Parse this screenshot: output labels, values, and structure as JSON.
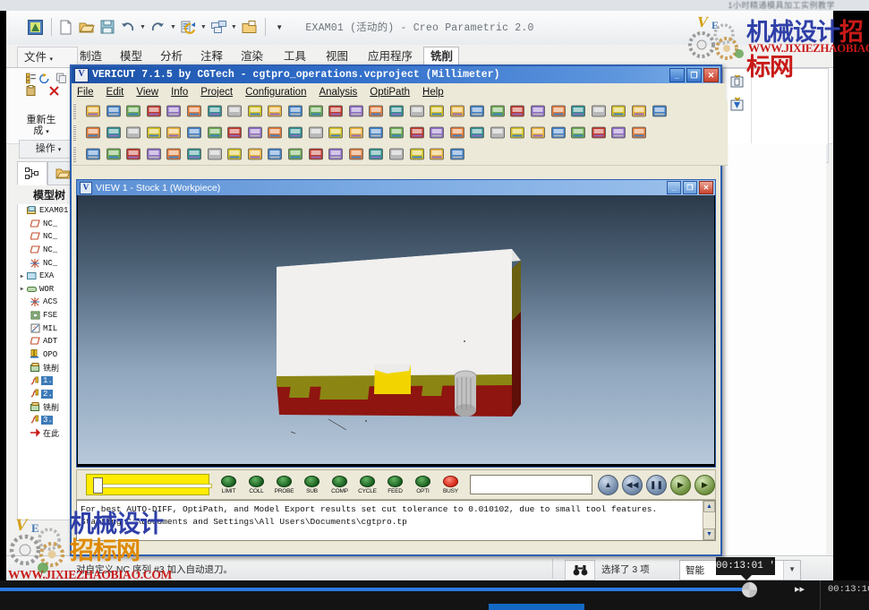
{
  "video": {
    "top_caption": "1小时精通模具加工实例教学",
    "time_current": "00:13:10/",
    "tooltip_time": "00:13:01 '"
  },
  "creo": {
    "title": "EXAM01 (活动的) - Creo Parametric 2.0",
    "quick_access": [
      {
        "name": "app-logo-icon",
        "glyph": "▣"
      },
      {
        "name": "new-file-icon",
        "glyph": "🗋"
      },
      {
        "name": "open-file-icon",
        "glyph": "📂"
      },
      {
        "name": "save-icon",
        "glyph": "💾"
      },
      {
        "name": "undo-icon",
        "glyph": "↶"
      },
      {
        "name": "redo-icon",
        "glyph": "↷"
      },
      {
        "name": "regenerate-icon",
        "glyph": "⟳"
      },
      {
        "name": "window-layout-icon",
        "glyph": "▤"
      },
      {
        "name": "close-window-icon",
        "glyph": "📁"
      },
      {
        "name": "overflow-icon",
        "glyph": "▼"
      }
    ],
    "tabs": [
      {
        "label": "文件",
        "selected": false,
        "has_arrow": true
      },
      {
        "label": "制造",
        "selected": false
      },
      {
        "label": "模型",
        "selected": false
      },
      {
        "label": "分析",
        "selected": false
      },
      {
        "label": "注释",
        "selected": false
      },
      {
        "label": "渲染",
        "selected": false
      },
      {
        "label": "工具",
        "selected": false
      },
      {
        "label": "视图",
        "selected": false
      },
      {
        "label": "应用程序",
        "selected": false
      },
      {
        "label": "铣削",
        "selected": true
      }
    ],
    "ribbon": {
      "regenerate_label": "重新生\n成",
      "operations_label": "操作"
    },
    "tree": {
      "header": "模型树",
      "tab_icons": [
        "model-tree-icon",
        "folder-browser-icon"
      ],
      "nodes": [
        {
          "label": "EXAM01.",
          "icon": "assembly-icon",
          "expander": "",
          "selected": false
        },
        {
          "label": "NC_",
          "icon": "datum-plane-icon",
          "expander": "",
          "selected": false
        },
        {
          "label": "NC_",
          "icon": "datum-plane-icon",
          "expander": "",
          "selected": false
        },
        {
          "label": "NC_",
          "icon": "datum-plane-icon",
          "expander": "",
          "selected": false
        },
        {
          "label": "NC_",
          "icon": "coord-sys-icon",
          "expander": "",
          "selected": false
        },
        {
          "label": "EXA",
          "icon": "part-icon",
          "expander": "▶",
          "selected": false
        },
        {
          "label": "WOR",
          "icon": "workpiece-icon",
          "expander": "▶",
          "selected": false
        },
        {
          "label": "ACS",
          "icon": "coord-sys-icon",
          "expander": "",
          "selected": false
        },
        {
          "label": "FSE",
          "icon": "fixture-icon",
          "expander": "",
          "selected": false
        },
        {
          "label": "MIL",
          "icon": "mill-op-icon",
          "expander": "",
          "selected": false
        },
        {
          "label": "ADT",
          "icon": "datum-plane-icon",
          "expander": "",
          "selected": false
        },
        {
          "label": "OPO",
          "icon": "tool-icon",
          "expander": "",
          "selected": false
        },
        {
          "label": "铣削",
          "icon": "nc-seq-icon",
          "expander": "",
          "selected": false
        },
        {
          "label": "1. ",
          "icon": "cut-motion-icon",
          "expander": "",
          "selected": true
        },
        {
          "label": "2. ",
          "icon": "cut-motion-icon",
          "expander": "",
          "selected": true
        },
        {
          "label": "铣削",
          "icon": "nc-seq-icon",
          "expander": "",
          "selected": false
        },
        {
          "label": "3. ",
          "icon": "cut-motion-icon",
          "expander": "",
          "selected": true
        },
        {
          "label": "在此",
          "icon": "insert-here-icon",
          "expander": "",
          "selected": false
        }
      ]
    },
    "statusbar": {
      "message": "对自定义 NC 序列 #3 加入自动退刀。",
      "find_icon": "binoculars-icon",
      "selection": "选择了 3 项",
      "filter_value": "智能",
      "filter_arrow": "▼"
    }
  },
  "vericut": {
    "title": "VERICUT 7.1.5 by CGTech - cgtpro_operations.vcproject (Millimeter)",
    "logo": "V",
    "window_buttons": [
      {
        "name": "minimize-button",
        "glyph": "_"
      },
      {
        "name": "maximize-button",
        "glyph": "❐"
      },
      {
        "name": "close-button",
        "glyph": "✕"
      }
    ],
    "menu": [
      {
        "label": "File"
      },
      {
        "label": "Edit"
      },
      {
        "label": "View"
      },
      {
        "label": "Info"
      },
      {
        "label": "Project"
      },
      {
        "label": "Configuration"
      },
      {
        "label": "Analysis"
      },
      {
        "label": "OptiPath"
      },
      {
        "label": "Help"
      }
    ],
    "toolbar_row1": [
      "open-project-icon",
      "open-vc-icon",
      "open-mm-icon",
      "open-folder-icon",
      "save-ip-icon",
      "save-up-icon",
      "import-icon",
      "new-model-icon",
      "report-icon",
      "save-as-icon",
      "open-m-icon",
      "open-c-icon",
      "tool-manager-icon",
      "enter-icon",
      "machine-icon",
      "g-code-icon",
      "apt-icon",
      "nc-program-icon",
      "stop-icon",
      "save-file-icon",
      "compare-icon",
      "shield-icon",
      "library-icon",
      "machine-setup-icon",
      "axis-icon",
      "model-h-icon",
      "model-g-icon",
      "merge-icon",
      "gm-xy-icon"
    ],
    "toolbar_row2": [
      "g1-icon",
      "step-icon",
      "step-all-icon",
      "tool-pick-icon",
      "verify-icon",
      "insert-icon",
      "diamond-gold-icon",
      "diamond-gray-icon",
      "diamond-green-icon",
      "section-icon",
      "colors-icon",
      "palette-icon",
      "zoom-icon",
      "zoom-in-icon",
      "zoom-out-icon",
      "fit-icon",
      "rotate-icon",
      "translate-icon",
      "refresh-icon",
      "measure-icon",
      "info-icon",
      "graph-icon",
      "autodiff-icon",
      "delete-x-icon",
      "feature-icon",
      "optipath-icon",
      "box-icon",
      "render-icon"
    ],
    "toolbar_row3": [
      "checker-icon",
      "record-icon",
      "anchor-icon",
      "view-icon",
      "print-icon",
      "rotate-x-icon",
      "rotate-y-icon",
      "rotate-z-icon",
      "rotate-xy-icon",
      "pan-icon",
      "perspective-icon",
      "layout-1-icon",
      "layout-2-icon",
      "layout-2h-icon",
      "layout-3-icon",
      "layout-3b-icon",
      "layout-4-icon",
      "spi-icon",
      "cancel-x-icon"
    ],
    "view_window": {
      "title": "VIEW 1 - Stock 1 (Workpiece)",
      "logo": "V",
      "buttons": [
        {
          "name": "view-minimize-button",
          "glyph": "_"
        },
        {
          "name": "view-maximize-button",
          "glyph": "❐"
        },
        {
          "name": "view-close-button",
          "glyph": "✕"
        }
      ],
      "colors": {
        "stock_top": "#f0efee",
        "stock_side": "#8f1410",
        "stock_band": "#8f8915",
        "cut_pocket": "#f2d500",
        "tool": "#b9b9b9"
      }
    },
    "controls": {
      "leds": [
        {
          "label": "LIMIT",
          "state": "green"
        },
        {
          "label": "COLL",
          "state": "green"
        },
        {
          "label": "PROBE",
          "state": "green"
        },
        {
          "label": "SUB",
          "state": "green"
        },
        {
          "label": "COMP",
          "state": "green"
        },
        {
          "label": "CYCLE",
          "state": "green"
        },
        {
          "label": "FEED",
          "state": "green"
        },
        {
          "label": "OPTI",
          "state": "green"
        },
        {
          "label": "BUSY",
          "state": "red"
        }
      ],
      "status_field": "",
      "nav_buttons": [
        {
          "name": "eject-button",
          "glyph": "▲"
        },
        {
          "name": "rewind-button",
          "glyph": "◀◀"
        },
        {
          "name": "pause-button",
          "glyph": "❚❚"
        },
        {
          "name": "step-button",
          "glyph": "▶"
        },
        {
          "name": "play-button",
          "glyph": "▶"
        }
      ]
    },
    "log": {
      "lines": [
        "For best AUTO-DIFF, OptiPath, and Model Export results set cut tolerance to 0.010102, due to small tool features.",
        "Starting C:\\Documents and Settings\\All Users\\Documents\\cgtpro.tp"
      ],
      "scroll_up": "▲",
      "scroll_down": "▼"
    }
  },
  "watermark": {
    "cn_line1": "机械设计",
    "cn_line2": "招标网",
    "url": "WWW.JIXIEZHAOBIAO.COM",
    "logo_mark": "VE",
    "colors": {
      "blue": "#2f3fa8",
      "red": "#c81a18",
      "orange": "#e08a00"
    }
  }
}
